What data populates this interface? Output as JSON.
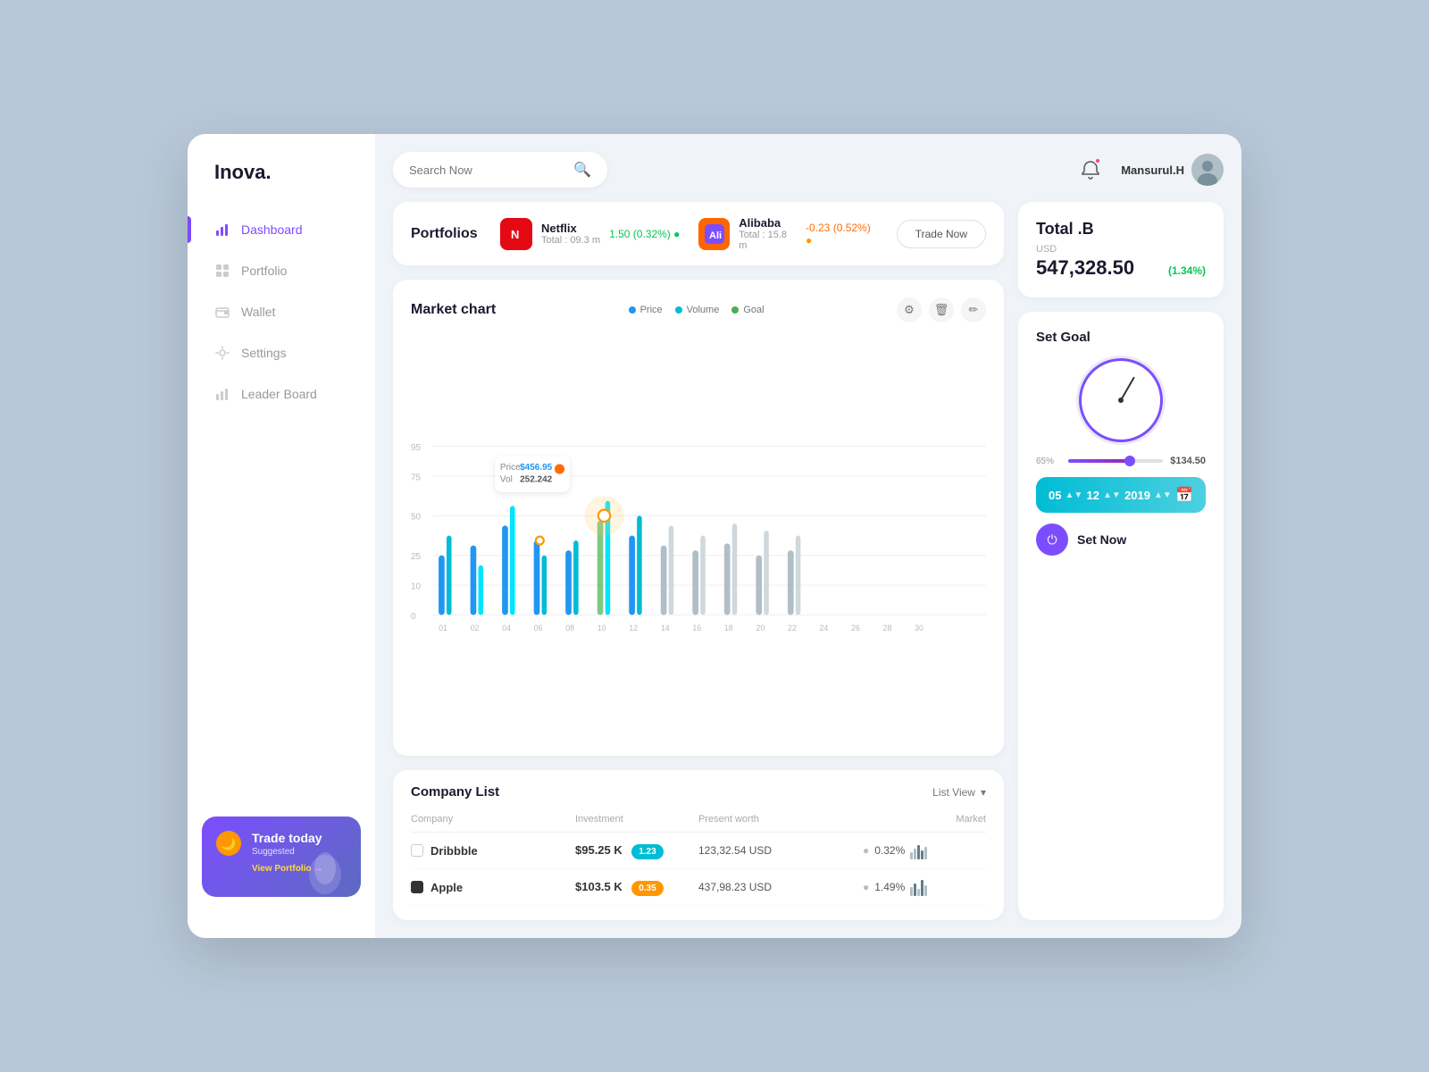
{
  "app": {
    "logo": "Inova.",
    "bg_color": "#b8c8d8"
  },
  "sidebar": {
    "items": [
      {
        "id": "dashboard",
        "label": "Dashboard",
        "active": true,
        "icon": "bar-chart-icon"
      },
      {
        "id": "portfolio",
        "label": "Portfolio",
        "active": false,
        "icon": "grid-icon"
      },
      {
        "id": "wallet",
        "label": "Wallet",
        "active": false,
        "icon": "wallet-icon"
      },
      {
        "id": "settings",
        "label": "Settings",
        "active": false,
        "icon": "settings-icon"
      },
      {
        "id": "leaderboard",
        "label": "Leader Board",
        "active": false,
        "icon": "leaderboard-icon"
      }
    ],
    "trade_card": {
      "title": "Trade today",
      "subtitle": "Suggested",
      "link": "View Portfolio →",
      "bg_gradient": "linear-gradient(135deg, #7c4dff, #5c6bc0)"
    }
  },
  "header": {
    "search_placeholder": "Search Now",
    "user_name": "Mansurul.H",
    "notification_label": "notifications"
  },
  "portfolios": {
    "section_title": "Portfolios",
    "items": [
      {
        "name": "Netflix",
        "total_label": "Total :",
        "total_value": "09.3 m",
        "change_val": "1.50",
        "change_pct": "0.32%",
        "change_dir": "up",
        "logo_color": "#e50914",
        "logo_char": "N"
      },
      {
        "name": "Alibaba",
        "total_label": "Total :",
        "total_value": "15.8 m",
        "change_val": "-0.23",
        "change_pct": "0.52%",
        "change_dir": "down",
        "logo_color": "#7c4dff",
        "logo_char": "A"
      }
    ],
    "trade_btn_label": "Trade Now"
  },
  "market_chart": {
    "title": "Market chart",
    "legend": [
      {
        "label": "Price",
        "color": "#2196f3"
      },
      {
        "label": "Volume",
        "color": "#00bcd4"
      },
      {
        "label": "Goal",
        "color": "#4caf50"
      }
    ],
    "tooltip": {
      "price_label": "Price",
      "price_val": "$456.95",
      "vol_label": "Vol",
      "vol_val": "252.242"
    },
    "x_labels": [
      "01",
      "02",
      "04",
      "06",
      "08",
      "10",
      "12",
      "14",
      "16",
      "18",
      "20",
      "22",
      "24",
      "26",
      "28",
      "30"
    ],
    "y_labels": [
      "95",
      "75",
      "50",
      "25",
      "10",
      "0"
    ]
  },
  "company_list": {
    "title": "Company List",
    "view_btn": "List View",
    "columns": [
      "Company",
      "Investment",
      "Present worth",
      "Market"
    ],
    "rows": [
      {
        "name": "Dribbble",
        "checked": false,
        "investment": "$95.25 K",
        "badge": "1.23",
        "badge_color": "cyan",
        "present_worth": "123,32.54 USD",
        "market_pct": "0.32%",
        "market_dir": "up"
      },
      {
        "name": "Apple",
        "checked": true,
        "investment": "$103.5 K",
        "badge": "0.35",
        "badge_color": "orange",
        "present_worth": "437,98.23 USD",
        "market_pct": "1.49%",
        "market_dir": "up"
      }
    ]
  },
  "total": {
    "title": "Total .B",
    "usd_label": "USD",
    "amount": "547,328.50",
    "change": "(1.34%)"
  },
  "set_goal": {
    "title": "Set Goal",
    "slider_pct": "65%",
    "slider_val": "$134.50",
    "date_fields": [
      {
        "val": "05",
        "suffix": "§"
      },
      {
        "val": "12",
        "suffix": "§"
      },
      {
        "val": "2019",
        "suffix": "§"
      }
    ],
    "set_now_label": "Set Now"
  }
}
